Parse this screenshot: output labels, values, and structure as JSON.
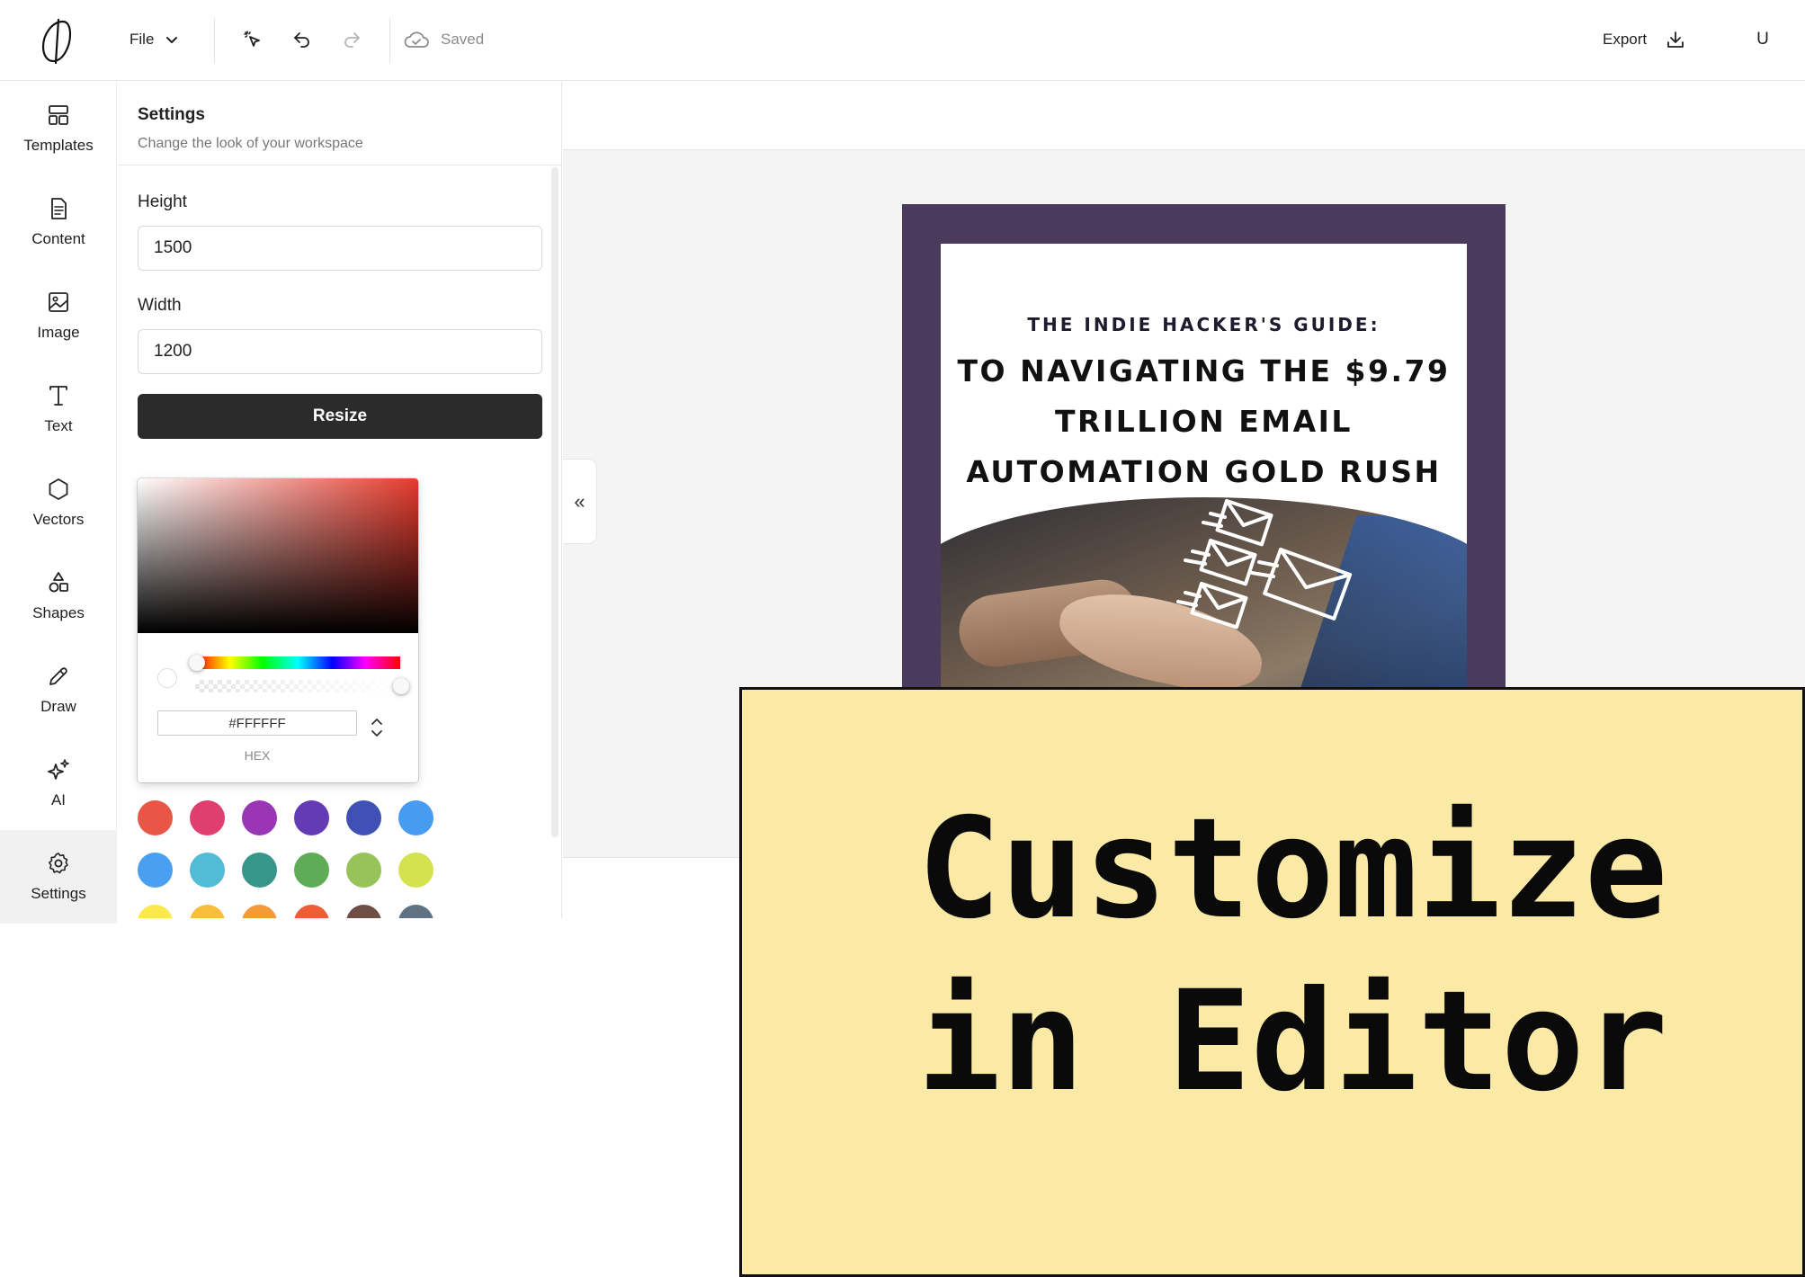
{
  "header": {
    "file_label": "File",
    "saved_label": "Saved",
    "export_label": "Export",
    "user_initial": "U"
  },
  "nav": {
    "items": [
      {
        "label": "Templates",
        "icon": "templates-icon"
      },
      {
        "label": "Content",
        "icon": "document-icon"
      },
      {
        "label": "Image",
        "icon": "image-icon"
      },
      {
        "label": "Text",
        "icon": "text-icon"
      },
      {
        "label": "Vectors",
        "icon": "hexagon-icon"
      },
      {
        "label": "Shapes",
        "icon": "shapes-icon"
      },
      {
        "label": "Draw",
        "icon": "pencil-icon"
      },
      {
        "label": "AI",
        "icon": "sparkle-icon"
      },
      {
        "label": "Settings",
        "icon": "gear-icon",
        "active": true
      }
    ]
  },
  "settings": {
    "title": "Settings",
    "subtitle": "Change the look of your workspace",
    "height_label": "Height",
    "height_value": "1500",
    "width_label": "Width",
    "width_value": "1200",
    "resize_label": "Resize"
  },
  "color_picker": {
    "hex_value": "#FFFFFF",
    "hex_label": "HEX",
    "hue_color": "#e53b2d",
    "swatches": [
      "#e85745",
      "#e03e6e",
      "#9a35b5",
      "#653ab5",
      "#3f51b5",
      "#479bf0",
      "#4a9ff0",
      "#52bcd6",
      "#37968a",
      "#5fac57",
      "#98c25a",
      "#d5e250",
      "#fbe84c",
      "#f8bd3b",
      "#f49a36",
      "#ee5d33",
      "#6e4e45",
      "#5f7384"
    ]
  },
  "canvas": {
    "collapse_glyph": "«",
    "design": {
      "kicker": "THE INDIE HACKER'S GUIDE:",
      "title_line1": "TO NAVIGATING THE $9.79",
      "title_line2": "TRILLION EMAIL",
      "title_line3": "AUTOMATION GOLD RUSH",
      "frame_color": "#4a3a5c"
    }
  },
  "overlay": {
    "text": "Customize\nin Editor",
    "background": "#fbe9a6"
  }
}
